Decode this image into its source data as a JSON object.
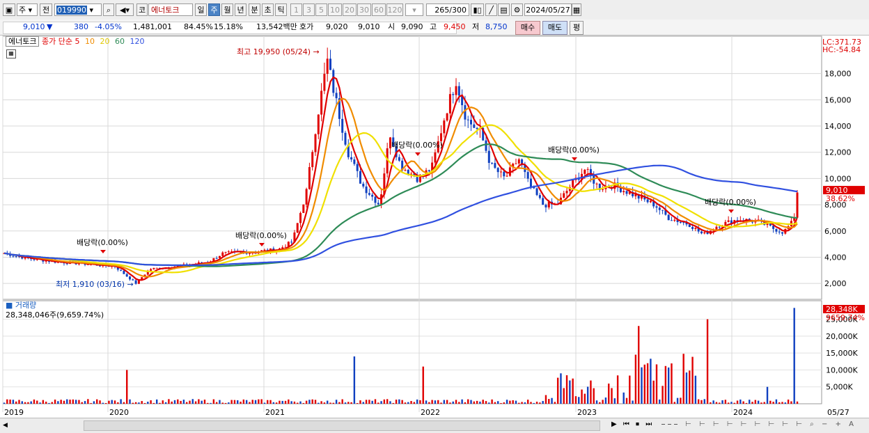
{
  "toolbar": {
    "market": "주",
    "prev": "전",
    "code": "019990",
    "name_prefix": "코",
    "name": "에너토크",
    "periods": [
      "일",
      "주",
      "월",
      "년",
      "분",
      "초",
      "틱"
    ],
    "active_period": "주",
    "ticks": [
      "1",
      "3",
      "5",
      "10",
      "20",
      "30",
      "60",
      "120"
    ],
    "count": "265",
    "count_total": "/300",
    "date": "2024/05/27"
  },
  "quote": {
    "price": "9,010",
    "arrow": "▼",
    "change": "380",
    "change_pct": "-4.05%",
    "volume": "1,481,001",
    "vol_ratio": "84.45%",
    "turnover": "15.18%",
    "amount": "13,542백만",
    "ask_label": "호가",
    "ask": "9,020",
    "bid": "9,010",
    "open_label": "시",
    "open": "9,090",
    "high_label": "고",
    "high": "9,450",
    "low_label": "저",
    "low": "8,750",
    "buy": "매수",
    "sell": "매도",
    "avg": "평"
  },
  "legend": {
    "name": "에너토크",
    "ma_label": "종가 단순",
    "ma_periods": [
      "5",
      "10",
      "20",
      "60",
      "120"
    ]
  },
  "colors": {
    "ma5": "#e00000",
    "ma10": "#f08c00",
    "ma20": "#f0e000",
    "ma60": "#2e8b57",
    "ma120": "#3050e0",
    "up": "#e00000",
    "down": "#1040c0"
  },
  "annotations": {
    "high": "최고 19,950 (05/24)",
    "low": "최저 1,910 (03/16)",
    "dividend": "배당락(0.00%)"
  },
  "price_axis": {
    "lc": "LC:371.73",
    "hc": "HC:-54.84",
    "ticks": [
      "18,000",
      "16,000",
      "14,000",
      "12,000",
      "10,000",
      "8,000",
      "6,000",
      "4,000",
      "2,000"
    ],
    "current": "9,010",
    "current_pct": "38.62%"
  },
  "volume_panel": {
    "title": "거래량",
    "value": "28,348,046주(9,659.74%)",
    "ticks": [
      "25,000K",
      "20,000K",
      "15,000K",
      "10,000K",
      "5,000K"
    ],
    "current": "28,348K",
    "current_pct": "9659.74%"
  },
  "x_axis": {
    "labels": [
      "2019",
      "2020",
      "2021",
      "2022",
      "2023",
      "2024"
    ],
    "last": "05/27"
  },
  "chart_data": {
    "type": "candlestick",
    "ma_series": [
      {
        "name": "5",
        "color": "#e00000"
      },
      {
        "name": "10",
        "color": "#f08c00"
      },
      {
        "name": "20",
        "color": "#f0e000"
      },
      {
        "name": "60",
        "color": "#2e8b57"
      },
      {
        "name": "120",
        "color": "#3050e0"
      }
    ],
    "ylim": [
      1000,
      20000
    ],
    "volume_ylim": [
      0,
      28000000
    ]
  }
}
